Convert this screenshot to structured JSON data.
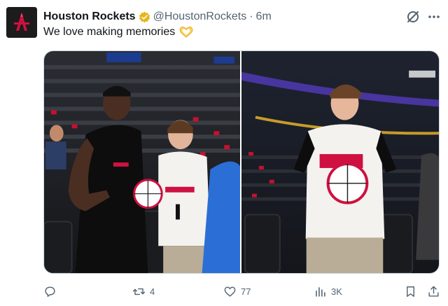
{
  "account": {
    "display_name": "Houston Rockets",
    "handle": "@HoustonRockets",
    "separator": "·",
    "time_ago": "6m",
    "avatar_icon": "rockets-logo-icon",
    "verified_icon": "verified-gold-badge-icon",
    "brand_color": "#ce1141",
    "verified_color": "#e2b719"
  },
  "tweet": {
    "text": "We love making memories",
    "emoji_icon": "heart-hands-emoji-icon"
  },
  "header_icons": [
    "grok-icon",
    "more-icon"
  ],
  "media": {
    "photos": [
      {
        "name": "photo-player-signing-ball"
      },
      {
        "name": "photo-fan-holding-signed-ball"
      }
    ]
  },
  "actions": {
    "reply": {
      "icon": "reply-icon",
      "count": ""
    },
    "repost": {
      "icon": "repost-icon",
      "count": "4"
    },
    "like": {
      "icon": "like-icon",
      "count": "77"
    },
    "views": {
      "icon": "views-icon",
      "count": "3K"
    },
    "bookmark": {
      "icon": "bookmark-icon"
    },
    "share": {
      "icon": "share-icon"
    }
  },
  "colors": {
    "text_primary": "#0f1419",
    "text_secondary": "#536471",
    "border": "#cfd9de"
  }
}
